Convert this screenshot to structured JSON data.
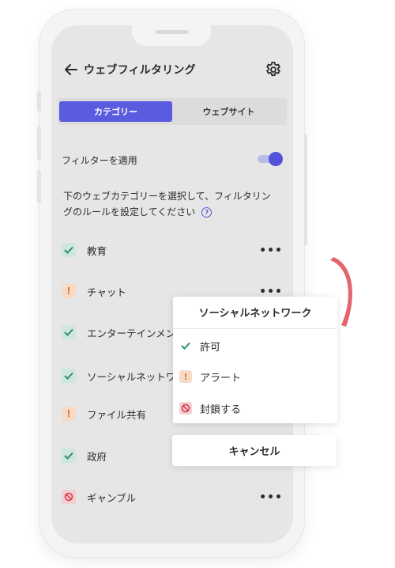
{
  "header": {
    "title": "ウェブフィルタリング",
    "back_icon": "arrow-left-icon",
    "settings_icon": "gear-icon"
  },
  "tabs": [
    {
      "label": "カテゴリー",
      "active": true
    },
    {
      "label": "ウェブサイト",
      "active": false
    }
  ],
  "filter": {
    "label": "フィルターを適用",
    "enabled": true
  },
  "description": {
    "line1": "下のウェブカテゴリーを選択して、フィルタリン",
    "line2": "グのルールを設定してください"
  },
  "categories": [
    {
      "label": "教育",
      "status": "allow",
      "more": "•••"
    },
    {
      "label": "チャット",
      "status": "alert",
      "more": "•••"
    },
    {
      "label": "エンターテインメン",
      "status": "allow"
    },
    {
      "label": "ソーシャルネットワ",
      "status": "allow"
    },
    {
      "label": "ファイル共有",
      "status": "alert"
    },
    {
      "label": "政府",
      "status": "allow"
    },
    {
      "label": "ギャンブル",
      "status": "block",
      "more": "•••"
    }
  ],
  "popup": {
    "title": "ソーシャルネットワーク",
    "options": [
      {
        "label": "許可",
        "status": "allow"
      },
      {
        "label": "アラート",
        "status": "alert"
      },
      {
        "label": "封鎖する",
        "status": "block"
      }
    ]
  },
  "cancel_label": "キャンセル",
  "colors": {
    "accent": "#5b5be0",
    "allow": "#2f8f6a",
    "alert": "#e07a2e",
    "block": "#d23b4a",
    "deco": "#e3646b"
  }
}
